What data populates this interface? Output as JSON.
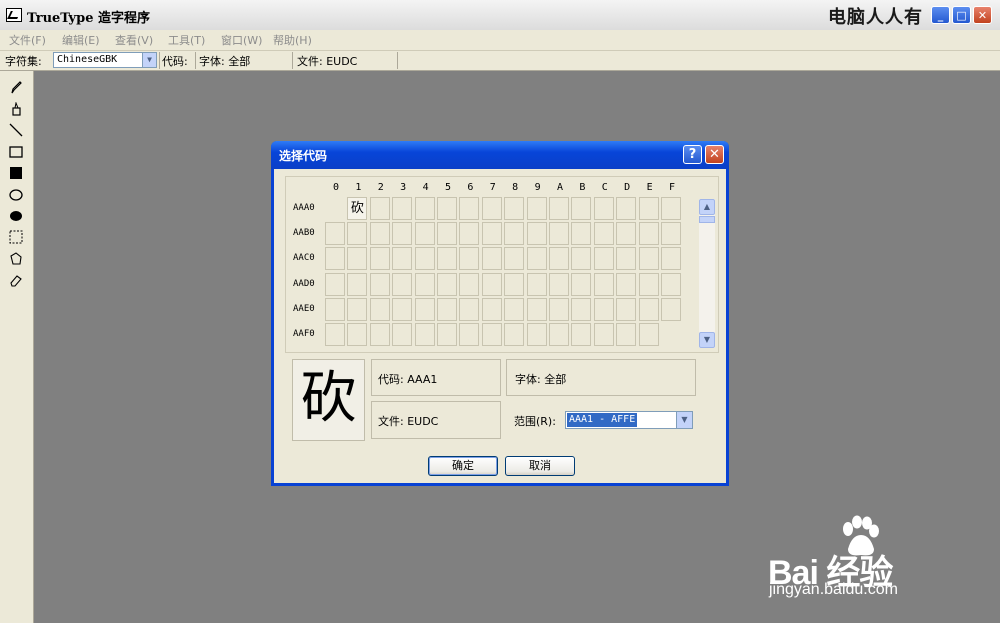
{
  "app": {
    "title": "TrueType 造字程序",
    "watermark_top": "电脑人人有"
  },
  "menu": [
    "文件(F)",
    "编辑(E)",
    "查看(V)",
    "工具(T)",
    "窗口(W)",
    "帮助(H)"
  ],
  "toolbar": {
    "charset_label": "字符集:",
    "charset_value": "ChineseGBK",
    "code_label": "代码:",
    "font_label": "字体: 全部",
    "file_label": "文件: EUDC"
  },
  "tools": [
    "pencil-icon",
    "brush-icon",
    "line-icon",
    "rectangle-outline-icon",
    "rectangle-filled-icon",
    "ellipse-outline-icon",
    "ellipse-filled-icon",
    "rect-select-icon",
    "freeform-select-icon",
    "eraser-icon"
  ],
  "dialog": {
    "title": "选择代码",
    "help_btn": "?",
    "close_btn": "✕",
    "columns": [
      "0",
      "1",
      "2",
      "3",
      "4",
      "5",
      "6",
      "7",
      "8",
      "9",
      "A",
      "B",
      "C",
      "D",
      "E",
      "F"
    ],
    "rows": [
      "AAA0",
      "AAB0",
      "AAC0",
      "AAD0",
      "AAE0",
      "AAF0"
    ],
    "filled_char": "砍",
    "preview_char": "砍",
    "code_info": "代码:   AAA1",
    "font_info": "字体:   全部",
    "file_info": "文件:   EUDC",
    "range_label": "范围(R):",
    "range_value": "AAA1 - AFFE",
    "ok": "确定",
    "cancel": "取消"
  },
  "watermark": {
    "logo": "Bai  经验",
    "url": "jingyan.baidu.com"
  }
}
